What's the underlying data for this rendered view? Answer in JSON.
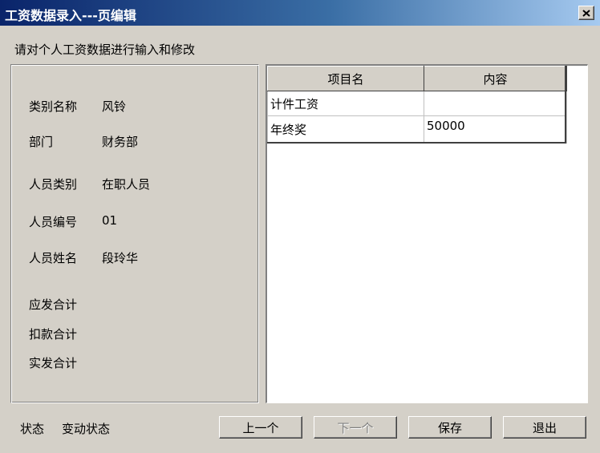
{
  "window": {
    "title": "工资数据录入---页编辑",
    "close_icon": "close-icon"
  },
  "instruction": "请对个人工资数据进行输入和修改",
  "info": {
    "category_label": "类别名称",
    "category_value": "风铃",
    "department_label": "部门",
    "department_value": "财务部",
    "staff_type_label": "人员类别",
    "staff_type_value": "在职人员",
    "staff_id_label": "人员编号",
    "staff_id_value": "01",
    "staff_name_label": "人员姓名",
    "staff_name_value": "段玲华",
    "payable_total_label": "应发合计",
    "deduction_total_label": "扣款合计",
    "net_total_label": "实发合计"
  },
  "grid": {
    "columns": [
      "项目名",
      "内容"
    ],
    "rows": [
      {
        "item": "计件工资",
        "content": ""
      },
      {
        "item": "年终奖",
        "content": "50000"
      }
    ]
  },
  "status": {
    "label": "状态",
    "value": "变动状态"
  },
  "buttons": {
    "prev": "上一个",
    "next": "下一个",
    "save": "保存",
    "exit": "退出"
  }
}
